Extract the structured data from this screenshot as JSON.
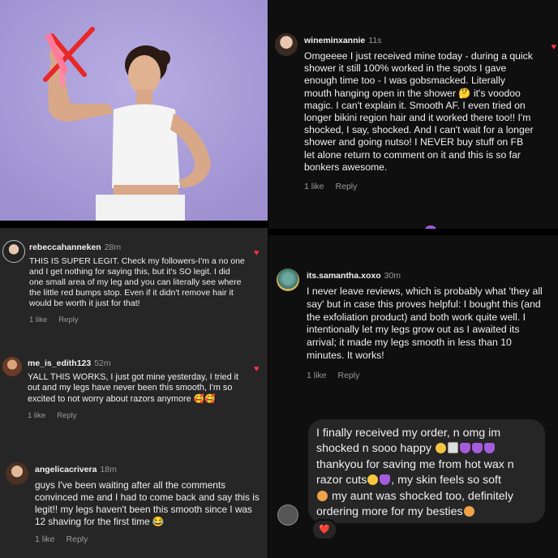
{
  "comments": [
    {
      "username": "wineminxannie",
      "time": "11s",
      "text": "Omgeeee I just received mine today - during a quick shower it still 100% worked in the spots I gave enough time too - I was gobsmacked. Literally mouth hanging open in the shower 🤔 it's voodoo magic. I can't explain it. Smooth AF. I even tried on longer bikini region hair and it worked there too!! I'm shocked, I say, shocked. And I can't wait for a longer shower and going nutso! I NEVER buy stuff on FB let alone return to comment on it and this is so far bonkers awesome.",
      "likes": "1 like",
      "reply": "Reply"
    },
    {
      "username": "rebeccahanneken",
      "time": "28m",
      "text": "THIS IS SUPER LEGIT. Check my followers-I'm a no one and I get nothing for saying this, but it's SO legit. I did one small area of my leg and you can literally see where the little red bumps stop. Even if it didn't remove hair it would be worth it just for that!",
      "likes": "1 like",
      "reply": "Reply"
    },
    {
      "username": "me_is_edith123",
      "time": "52m",
      "text": "YALL THIS WORKS, I just got mine yesterday, I tried it out and my legs have never been this smooth, I'm so excited to not worry about razors anymore 🥰🥰",
      "likes": "1 like",
      "reply": "Reply"
    },
    {
      "username": "angelicacrivera",
      "time": "18m",
      "text": "guys I've been waiting after all the comments convinced me and I had to come back and say this is legit!! my legs haven't been this smooth since I was 12 shaving for the first time 😂",
      "likes": "1 like",
      "reply": "Reply"
    },
    {
      "username": "its.samantha.xoxo",
      "time": "30m",
      "text": "I never leave reviews, which is probably what 'they all say' but in case this proves helpful: I bought this (and the exfoliation product) and both work quite well. I intentionally let my legs grow out as I awaited its arrival; it made my legs smooth in less than 10 minutes. It works!",
      "likes": "1 like",
      "reply": "Reply"
    }
  ],
  "message": {
    "line1": "I finally received my order, n omg im",
    "line2": "shocked n sooo happy",
    "line3": "thankyou for saving me from hot wax n",
    "line4": "razor cuts",
    "line4b": ", my skin feels so soft",
    "line5": "my aunt was shocked too, definitely",
    "line6": "ordering more for my besties",
    "reaction": "❤️"
  },
  "colors": {
    "purple_bg": "#a89bd8",
    "accent_red": "#ff3040",
    "bubble": "#262626"
  },
  "icons": [
    "heart-icon",
    "avatar",
    "razor-crossed-icon"
  ]
}
